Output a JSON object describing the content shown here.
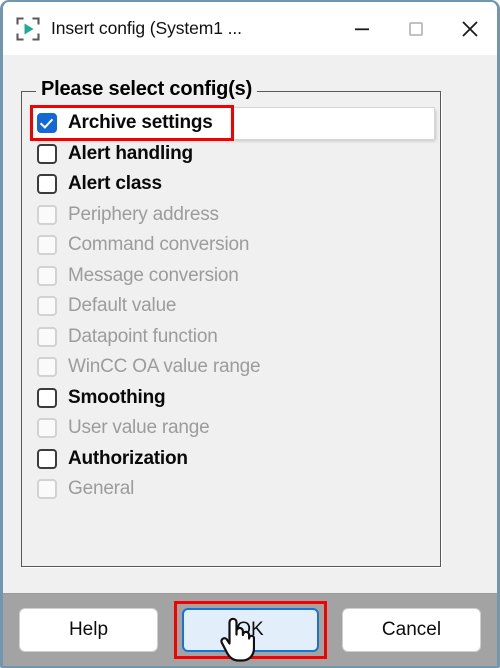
{
  "window": {
    "title": "Insert config (System1 ...",
    "icon": "play-in-brackets-icon",
    "controls": {
      "minimize": "minimize-icon",
      "maximize": "maximize-icon",
      "close": "close-icon"
    },
    "border_color": "#7196ad",
    "titlebar_bg": "#ffffff",
    "client_bg": "#f0f0f0",
    "bottombar_bg": "#a3a3a3"
  },
  "group": {
    "title": "Please select config(s)",
    "items": [
      {
        "label": "Archive settings",
        "checked": true,
        "enabled": true,
        "highlighted": true
      },
      {
        "label": "Alert handling",
        "checked": false,
        "enabled": true,
        "highlighted": false
      },
      {
        "label": "Alert class",
        "checked": false,
        "enabled": true,
        "highlighted": false
      },
      {
        "label": "Periphery address",
        "checked": false,
        "enabled": false,
        "highlighted": false
      },
      {
        "label": "Command conversion",
        "checked": false,
        "enabled": false,
        "highlighted": false
      },
      {
        "label": "Message conversion",
        "checked": false,
        "enabled": false,
        "highlighted": false
      },
      {
        "label": "Default value",
        "checked": false,
        "enabled": false,
        "highlighted": false
      },
      {
        "label": "Datapoint function",
        "checked": false,
        "enabled": false,
        "highlighted": false
      },
      {
        "label": "WinCC OA value range",
        "checked": false,
        "enabled": false,
        "highlighted": false
      },
      {
        "label": "Smoothing",
        "checked": false,
        "enabled": true,
        "highlighted": false
      },
      {
        "label": "User value range",
        "checked": false,
        "enabled": false,
        "highlighted": false
      },
      {
        "label": "Authorization",
        "checked": false,
        "enabled": true,
        "highlighted": false
      },
      {
        "label": "General",
        "checked": false,
        "enabled": false,
        "highlighted": false
      }
    ]
  },
  "buttons": {
    "help": "Help",
    "ok": "OK",
    "cancel": "Cancel"
  },
  "annotations": {
    "color": "#f40000",
    "targets": [
      "archive-settings-row",
      "ok-button"
    ]
  },
  "cursor": "hand-pointer-cursor",
  "colors": {
    "accent_blue": "#1269d3",
    "ok_border": "#1874d2",
    "ok_fill": "#e2effb",
    "disabled_text": "#9c9c9c",
    "icon_teal": "#21a89b"
  }
}
